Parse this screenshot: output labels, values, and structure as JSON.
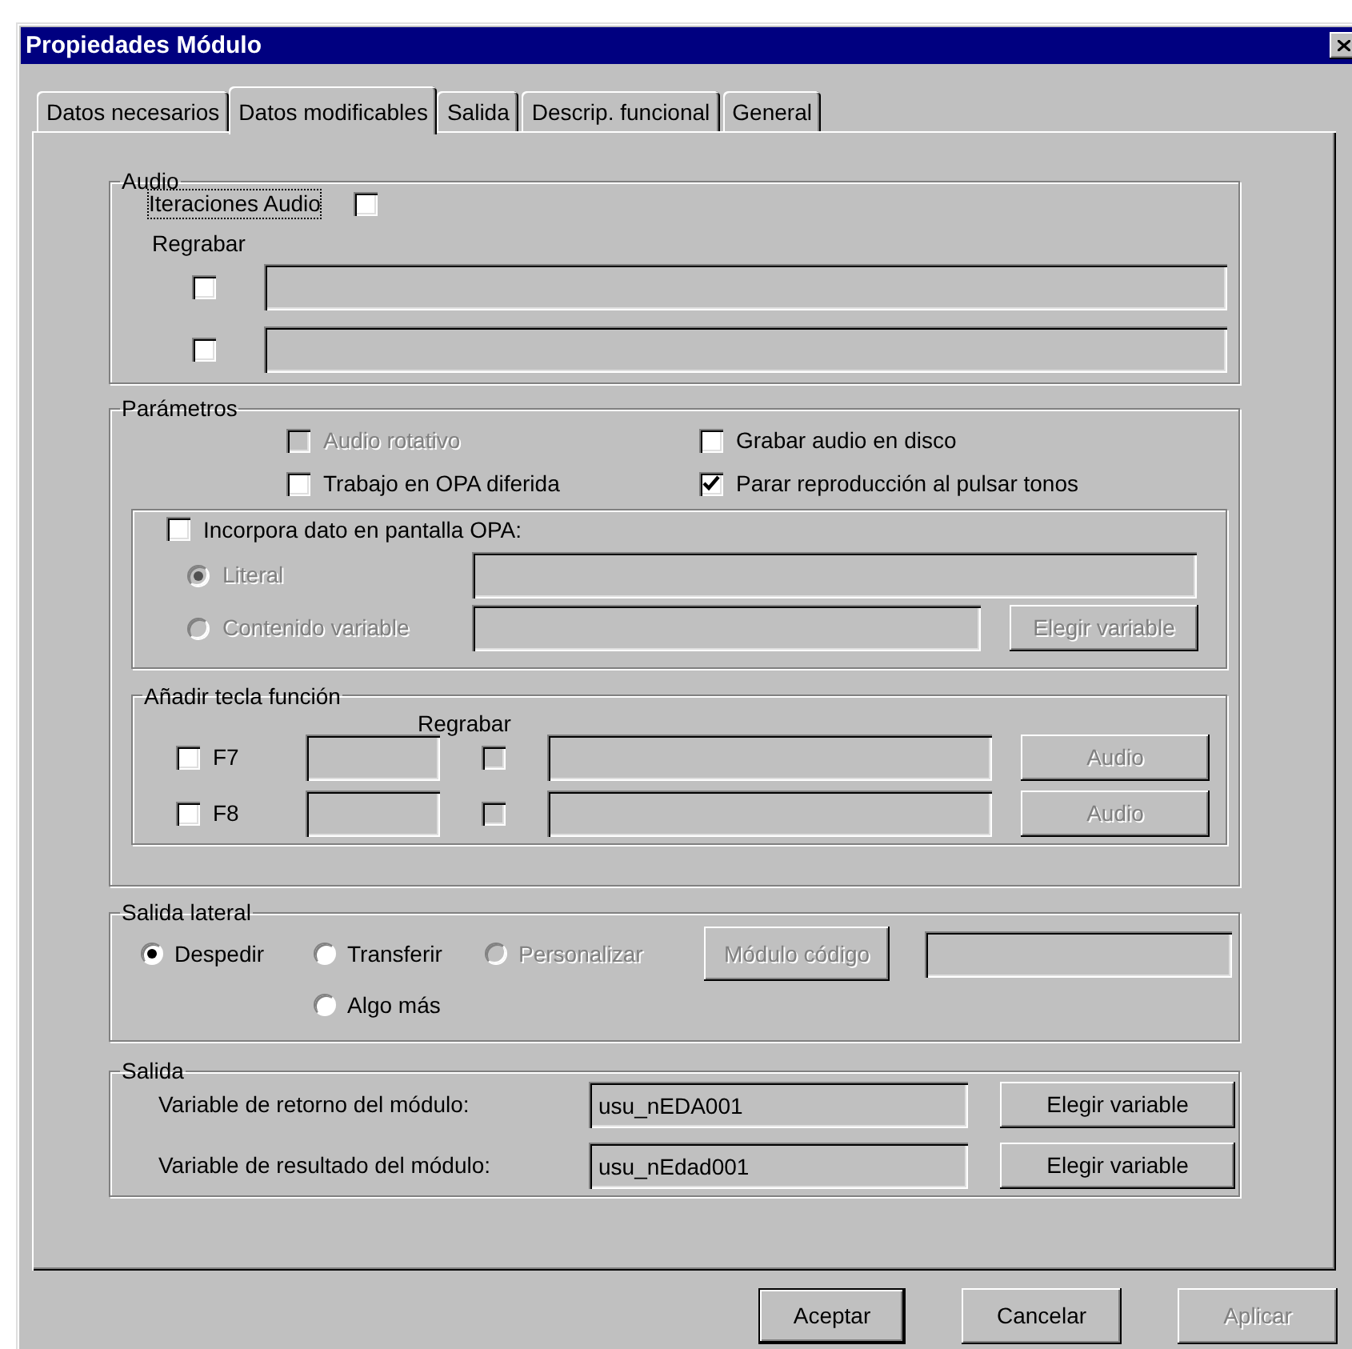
{
  "window": {
    "title": "Propiedades Módulo"
  },
  "tabs": [
    {
      "label": "Datos necesarios",
      "selected": false
    },
    {
      "label": "Datos modificables",
      "selected": true
    },
    {
      "label": "Salida",
      "selected": false
    },
    {
      "label": "Descrip. funcional",
      "selected": false
    },
    {
      "label": "General",
      "selected": false
    }
  ],
  "audio": {
    "legend": "Audio",
    "iterations": {
      "label": "Iteraciones Audio",
      "checked": false,
      "focused": true
    },
    "rerecord_label": "Regrabar",
    "rows": [
      {
        "checked": false
      },
      {
        "checked": false
      }
    ]
  },
  "parameters": {
    "legend": "Parámetros",
    "options": [
      {
        "label": "Audio rotativo",
        "checked": false,
        "disabled": true
      },
      {
        "label": "Grabar audio en disco",
        "checked": false,
        "disabled": false
      },
      {
        "label": "Trabajo en OPA diferida",
        "checked": false,
        "disabled": false
      },
      {
        "label": "Parar reproducción al pulsar tonos",
        "checked": true,
        "disabled": false
      }
    ],
    "display": {
      "label": "Incorpora dato en pantalla OPA:",
      "checked": false,
      "choices": [
        {
          "label": "Literal",
          "selected": true,
          "disabled": true
        },
        {
          "label": "Contenido variable",
          "selected": false,
          "disabled": true
        }
      ],
      "button": {
        "label": "Elegir variable",
        "disabled": true
      }
    },
    "function_keys": {
      "legend": "Añadir tecla función",
      "rerecord_label": "Regrabar",
      "rows": [
        {
          "key": "F7",
          "checked": false,
          "rerecord_checked": false,
          "rerecord_disabled": true,
          "button": "Audio",
          "button_disabled": true
        },
        {
          "key": "F8",
          "checked": false,
          "rerecord_checked": false,
          "rerecord_disabled": true,
          "button": "Audio",
          "button_disabled": true
        }
      ]
    }
  },
  "side_exit": {
    "legend": "Salida lateral",
    "choices": [
      {
        "label": "Despedir",
        "selected": true,
        "disabled": false
      },
      {
        "label": "Transferir",
        "selected": false,
        "disabled": false
      },
      {
        "label": "Personalizar",
        "selected": false,
        "disabled": true
      },
      {
        "label": "Algo más",
        "selected": false,
        "disabled": false
      }
    ],
    "button": {
      "label": "Módulo código",
      "disabled": true
    }
  },
  "output": {
    "legend": "Salida",
    "rows": [
      {
        "label": "Variable de retorno del módulo:",
        "value": "usu_nEDA001",
        "button": "Elegir variable"
      },
      {
        "label": "Variable de resultado del módulo:",
        "value": "usu_nEdad001",
        "button": "Elegir variable"
      }
    ]
  },
  "buttons": [
    {
      "label": "Aceptar",
      "default": true,
      "disabled": false
    },
    {
      "label": "Cancelar",
      "default": false,
      "disabled": false
    },
    {
      "label": "Aplicar",
      "default": false,
      "disabled": true
    }
  ]
}
